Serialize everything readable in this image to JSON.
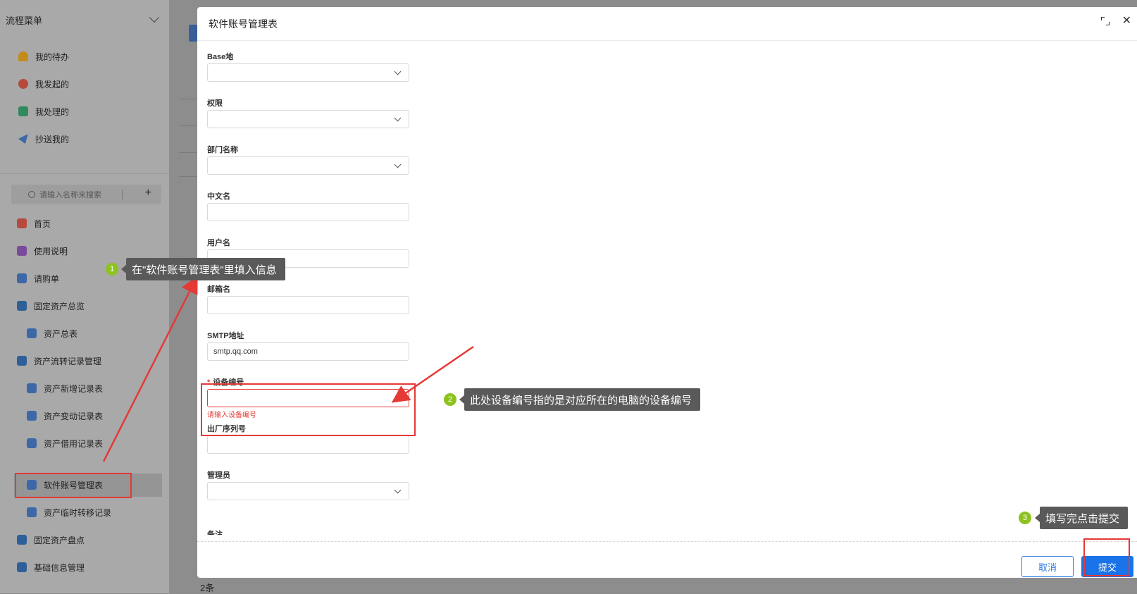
{
  "sidebar": {
    "header": "流程菜单",
    "top_items": [
      "我的待办",
      "我发起的",
      "我处理的",
      "抄送我的"
    ],
    "search_placeholder": "请输入名称来搜索",
    "menu": [
      "首页",
      "使用说明",
      "请购单",
      "固定资产总览",
      "资产总表",
      "资产流转记录管理",
      "资产新增记录表",
      "资产变动记录表",
      "资产借用记录表",
      "软件账号管理表",
      "资产临时转移记录",
      "固定资产盘点",
      "基础信息管理"
    ]
  },
  "background": {
    "count_text": "2条"
  },
  "dialog": {
    "title": "软件账号管理表",
    "fields": [
      {
        "label": "Base地",
        "value": ""
      },
      {
        "label": "权限",
        "value": ""
      },
      {
        "label": "部门名称",
        "value": ""
      },
      {
        "label": "中文名",
        "value": ""
      },
      {
        "label": "用户名",
        "value": ""
      },
      {
        "label": "邮箱名",
        "value": ""
      },
      {
        "label": "SMTP地址",
        "value": "smtp.qq.com"
      },
      {
        "label": "设备编号",
        "value": "",
        "error": "请输入设备编号"
      },
      {
        "label": "出厂序列号",
        "value": ""
      },
      {
        "label": "管理员",
        "value": ""
      }
    ],
    "cut_label": "备注",
    "cancel_label": "取消",
    "submit_label": "提交"
  },
  "annotations": [
    {
      "num": "1",
      "text": "在\"软件账号管理表\"里填入信息"
    },
    {
      "num": "2",
      "text": "此处设备编号指的是对应所在的电脑的设备编号"
    },
    {
      "num": "3",
      "text": "填写完点击提交"
    }
  ],
  "colors": {
    "primary": "#1a73e8",
    "annotation_red": "#e53935",
    "badge_green": "#8dc21f"
  }
}
